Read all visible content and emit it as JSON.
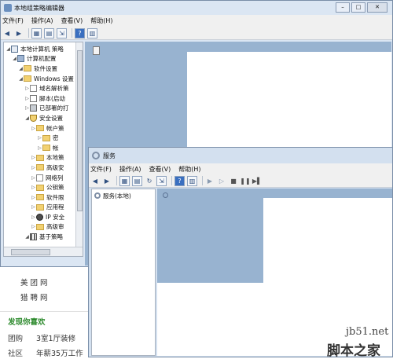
{
  "gp_window": {
    "title": "本地组策略编辑器",
    "sys_buttons": [
      "–",
      "□",
      "✕"
    ],
    "menu": [
      "文件(F)",
      "操作(A)",
      "查看(V)",
      "帮助(H)"
    ],
    "tree": [
      {
        "label": "本地计算机 策略",
        "indent": 0,
        "icon": "policy-icon"
      },
      {
        "label": "计算机配置",
        "indent": 1,
        "icon": "computer-icon"
      },
      {
        "label": "软件设置",
        "indent": 2,
        "icon": "folder-icon"
      },
      {
        "label": "Windows 设置",
        "indent": 2,
        "icon": "folder-icon"
      },
      {
        "label": "域名解析策",
        "indent": 3,
        "icon": "document-icon"
      },
      {
        "label": "脚本(启动",
        "indent": 3,
        "icon": "script-icon"
      },
      {
        "label": "已部署的打",
        "indent": 3,
        "icon": "printer-icon"
      },
      {
        "label": "安全设置",
        "indent": 3,
        "icon": "shield-icon"
      },
      {
        "label": "帐户策",
        "indent": 4,
        "icon": "folder-icon"
      },
      {
        "label": "密",
        "indent": 5,
        "icon": "folder-icon"
      },
      {
        "label": "帐",
        "indent": 5,
        "icon": "folder-icon"
      },
      {
        "label": "本地策",
        "indent": 4,
        "icon": "folder-icon"
      },
      {
        "label": "高级安",
        "indent": 4,
        "icon": "folder-icon"
      },
      {
        "label": "网络列",
        "indent": 4,
        "icon": "document-icon"
      },
      {
        "label": "公钥策",
        "indent": 4,
        "icon": "folder-icon"
      },
      {
        "label": "软件限",
        "indent": 4,
        "icon": "folder-icon"
      },
      {
        "label": "应用程",
        "indent": 4,
        "icon": "folder-icon"
      },
      {
        "label": "IP 安全",
        "indent": 4,
        "icon": "network-icon"
      },
      {
        "label": "高级审",
        "indent": 4,
        "icon": "folder-icon"
      },
      {
        "label": "基于策略",
        "indent": 3,
        "icon": "chart-icon"
      }
    ]
  },
  "svc_window": {
    "title": "服务",
    "menu": [
      "文件(F)",
      "操作(A)",
      "查看(V)",
      "帮助(H)"
    ],
    "tree_item": "服务(本地)"
  },
  "webpage": {
    "nav": [
      "美 团 网",
      "猎 聘 网"
    ],
    "section_title": "发现你喜欢",
    "rows": [
      {
        "tag": "团购",
        "text": "3室1厅装修"
      },
      {
        "tag": "社区",
        "text": "年薪35万工作"
      }
    ],
    "watermark_url": "jb51.net",
    "watermark_name": "脚本之家"
  },
  "colors": {
    "mmc_blue": "#98b3d0",
    "section_title": "#2d8a2d"
  }
}
